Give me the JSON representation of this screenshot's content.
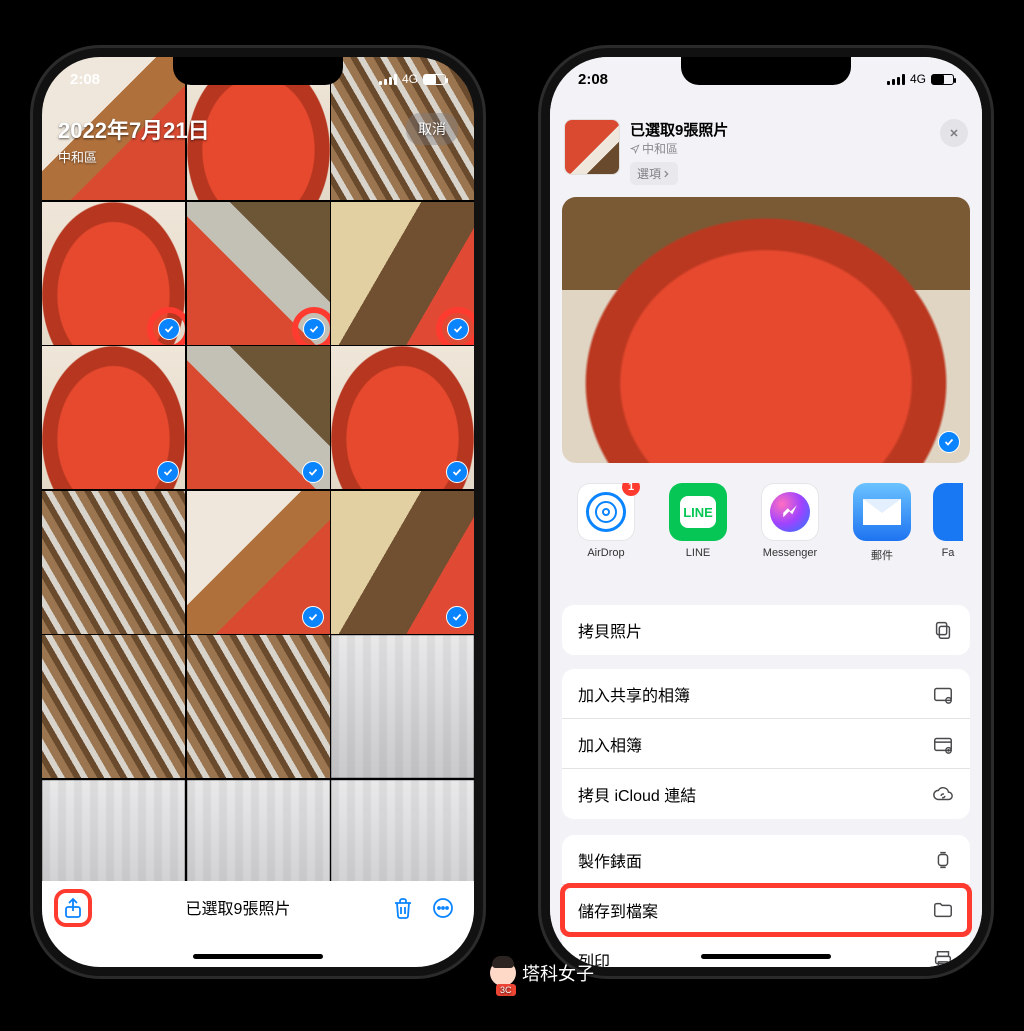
{
  "status": {
    "time": "2:08",
    "network": "4G"
  },
  "left": {
    "date_title": "2022年7月21日",
    "location": "中和區",
    "cancel": "取消",
    "toolbar_status": "已選取9張照片",
    "checks_highlighted": [
      3,
      4,
      5
    ],
    "checks_normal": [
      6,
      7,
      8,
      10,
      11
    ]
  },
  "right": {
    "header_title": "已選取9張照片",
    "header_sub": "中和區",
    "options_label": "選項",
    "apps": [
      {
        "name": "AirDrop",
        "kind": "airdrop",
        "badge": "1"
      },
      {
        "name": "LINE",
        "kind": "line"
      },
      {
        "name": "Messenger",
        "kind": "mess"
      },
      {
        "name": "郵件",
        "kind": "mail"
      },
      {
        "name": "Fa",
        "kind": "fb"
      }
    ],
    "group1": [
      {
        "label": "拷貝照片",
        "icon": "copy"
      }
    ],
    "group2": [
      {
        "label": "加入共享的相簿",
        "icon": "shared-album"
      },
      {
        "label": "加入相簿",
        "icon": "album-add"
      },
      {
        "label": "拷貝 iCloud 連結",
        "icon": "cloud-link"
      }
    ],
    "group3": [
      {
        "label": "製作錶面",
        "icon": "watch"
      },
      {
        "label": "儲存到檔案",
        "icon": "folder",
        "highlight": true
      },
      {
        "label": "列印",
        "icon": "printer"
      }
    ]
  },
  "watermark": "塔科女子"
}
